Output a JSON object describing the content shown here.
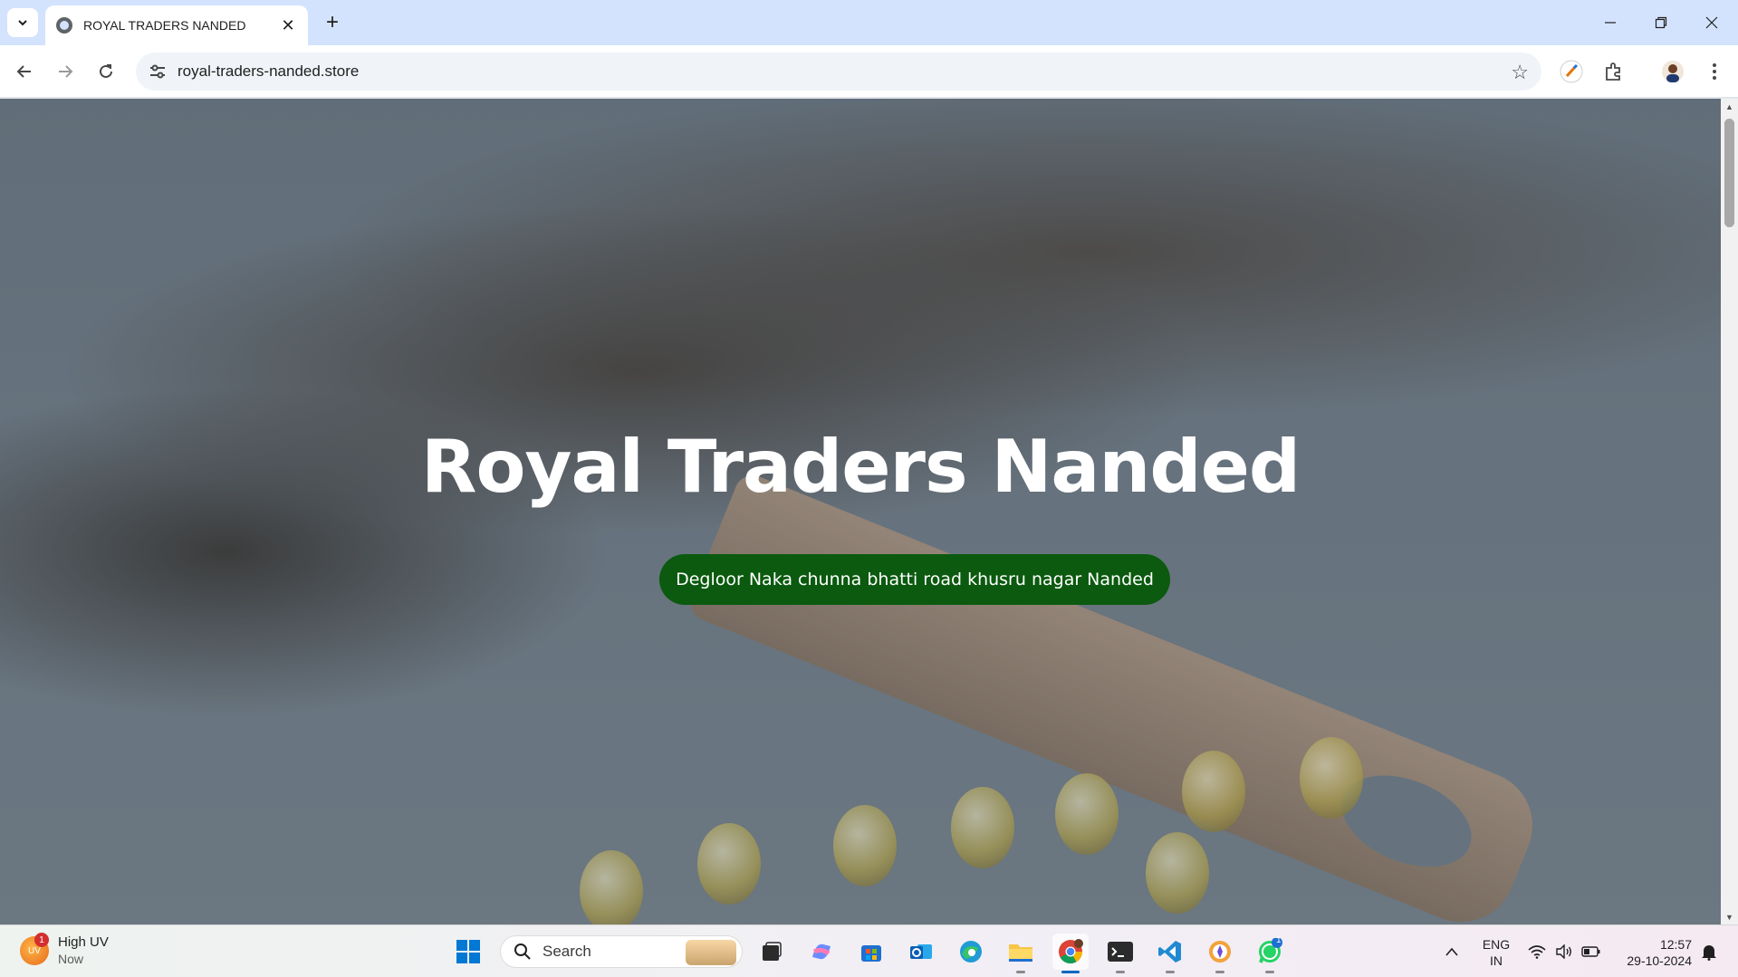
{
  "browser": {
    "tab_title": "ROYAL TRADERS NANDED",
    "url": "royal-traders-nanded.store"
  },
  "page": {
    "hero_title": "Royal Traders Nanded",
    "address_button": "Degloor Naka chunna bhatti road khusru nagar Nanded",
    "accent_color": "#0b5a0f"
  },
  "taskbar": {
    "weather_title": "High UV",
    "weather_sub": "Now",
    "weather_badge": "1",
    "search_label": "Search",
    "whatsapp_badge": "1",
    "lang_top": "ENG",
    "lang_bottom": "IN",
    "time": "12:57",
    "date": "29-10-2024"
  },
  "icons": [
    "tab-search-icon",
    "globe-icon",
    "close-icon",
    "plus-icon",
    "minimize-icon",
    "restore-icon",
    "window-close-icon",
    "back-icon",
    "forward-icon",
    "reload-icon",
    "site-info-icon",
    "star-icon",
    "paint-icon",
    "extensions-icon",
    "avatar",
    "more-icon",
    "windows-start-icon",
    "search-icon",
    "task-view-icon",
    "copilot-icon",
    "store-icon",
    "outlook-icon",
    "edge-icon",
    "file-explorer-icon",
    "chrome-icon",
    "terminal-icon",
    "vscode-icon",
    "app-icon",
    "whatsapp-icon",
    "chevron-up-icon",
    "wifi-icon",
    "volume-icon",
    "battery-icon",
    "notification-icon"
  ]
}
